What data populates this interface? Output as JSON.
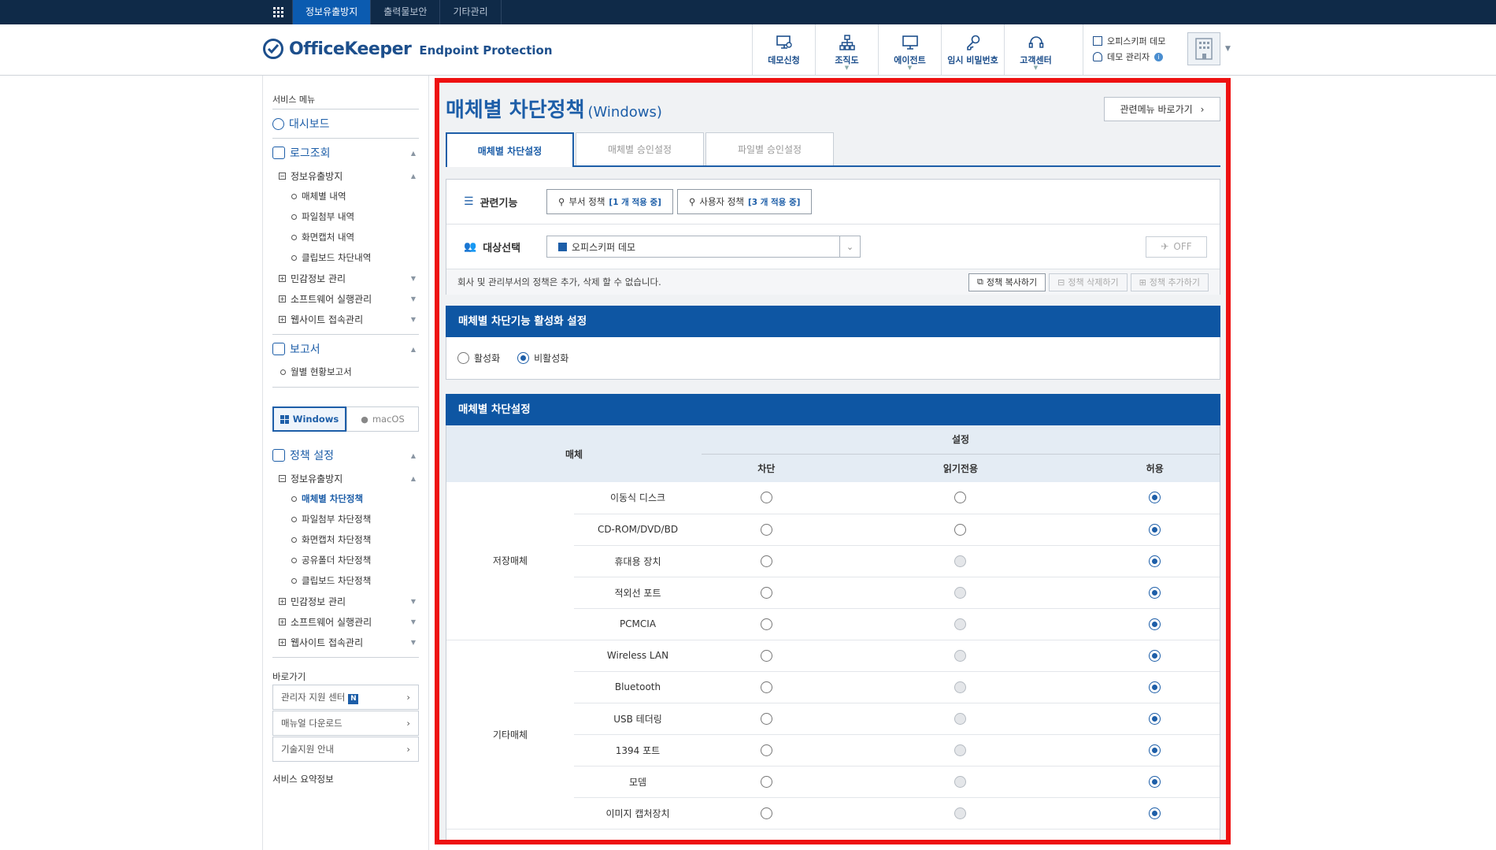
{
  "topnav": {
    "items": [
      "정보유출방지",
      "출력물보안",
      "기타관리"
    ]
  },
  "header": {
    "logo_main": "OfficeKeeper",
    "logo_sub": "Endpoint Protection",
    "buttons": [
      "데모신청",
      "조직도",
      "에이전트",
      "임시 비밀번호",
      "고객센터"
    ],
    "company": "오피스키퍼 데모",
    "admin": "데모 관리자"
  },
  "sidebar": {
    "title": "서비스 메뉴",
    "dashboard": "대시보드",
    "log": "로그조회",
    "log_group": "정보유출방지",
    "log_items": [
      "매체별 내역",
      "파일첨부 내역",
      "화면캡처 내역",
      "클립보드 차단내역"
    ],
    "log_more": [
      "민감정보 관리",
      "소프트웨어 실행관리",
      "웹사이트 접속관리"
    ],
    "report": "보고서",
    "report_items": [
      "월별 현황보고서"
    ],
    "os_tabs": [
      "Windows",
      "macOS"
    ],
    "policy": "정책 설정",
    "policy_group": "정보유출방지",
    "policy_items": [
      "매체별 차단정책",
      "파일첨부 차단정책",
      "화면캡처 차단정책",
      "공유폴더 차단정책",
      "클립보드 차단정책"
    ],
    "policy_more": [
      "민감정보 관리",
      "소프트웨어 실행관리",
      "웹사이트 접속관리"
    ],
    "quick_title": "바로가기",
    "quick_links": [
      "관리자 지원 센터",
      "매뉴얼 다운로드",
      "기술지원 안내"
    ],
    "new_badge": "N",
    "summary_title": "서비스 요약정보"
  },
  "main": {
    "title": "매체별 차단정책",
    "title_suffix": "(Windows)",
    "related_btn": "관련메뉴 바로가기",
    "tabs": [
      "매체별 차단설정",
      "매체별 승인설정",
      "파일별 승인설정"
    ],
    "related_label": "관련기능",
    "dept_policy": "부서 정책",
    "dept_count": "[1 개 적용 중]",
    "user_policy": "사용자 정책",
    "user_count": "[3 개 적용 중]",
    "target_label": "대상선택",
    "target_value": "오피스키퍼 데모",
    "off_label": "OFF",
    "note": "회사 및 관리부서의 정책은 추가, 삭제 할 수 없습니다.",
    "copy_btn": "정책 복사하기",
    "delete_btn": "정책 삭제하기",
    "add_btn": "정책 추가하기",
    "activation_title": "매체별 차단기능 활성화 설정",
    "activation_options": [
      "활성화",
      "비활성화"
    ],
    "activation_selected": "비활성화",
    "block_title": "매체별 차단설정",
    "col_media": "매체",
    "col_setting": "설정",
    "col_block": "차단",
    "col_readonly": "읽기전용",
    "col_allow": "허용",
    "categories": [
      {
        "name": "저장매체",
        "items": [
          {
            "name": "이동식 디스크",
            "readonly_enabled": true,
            "value": "허용"
          },
          {
            "name": "CD-ROM/DVD/BD",
            "readonly_enabled": true,
            "value": "허용"
          },
          {
            "name": "휴대용 장치",
            "readonly_enabled": false,
            "value": "허용"
          },
          {
            "name": "적외선 포트",
            "readonly_enabled": false,
            "value": "허용"
          },
          {
            "name": "PCMCIA",
            "readonly_enabled": false,
            "value": "허용"
          }
        ]
      },
      {
        "name": "기타매체",
        "items": [
          {
            "name": "Wireless LAN",
            "readonly_enabled": false,
            "value": "허용"
          },
          {
            "name": "Bluetooth",
            "readonly_enabled": false,
            "value": "허용"
          },
          {
            "name": "USB 테더링",
            "readonly_enabled": false,
            "value": "허용"
          },
          {
            "name": "1394 포트",
            "readonly_enabled": false,
            "value": "허용"
          },
          {
            "name": "모뎀",
            "readonly_enabled": false,
            "value": "허용"
          },
          {
            "name": "이미지 캡처장치",
            "readonly_enabled": false,
            "value": "허용"
          }
        ]
      }
    ]
  },
  "colors": {
    "brand": "#1d5ea8",
    "section_header": "#0e56a3",
    "topbar": "#0f2a48",
    "highlight_border": "#ee1111"
  }
}
